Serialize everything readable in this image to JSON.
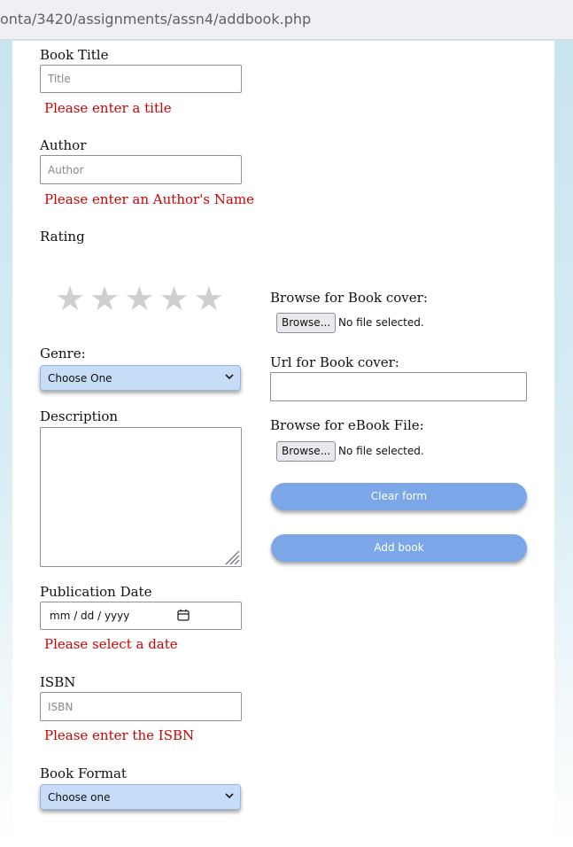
{
  "browser": {
    "url": "onta/3420/assignments/assn4/addbook.php"
  },
  "form": {
    "title": {
      "label": "Book Title",
      "placeholder": "Title",
      "error": "Please enter a title"
    },
    "author": {
      "label": "Author",
      "placeholder": "Author",
      "error": "Please enter an Author's Name"
    },
    "rating": {
      "label": "Rating",
      "stars": [
        "★",
        "★",
        "★",
        "★",
        "★"
      ],
      "value": 0
    },
    "genre": {
      "label": "Genre:",
      "selected": "Choose One"
    },
    "description": {
      "label": "Description"
    },
    "publication_date": {
      "label": "Publication Date",
      "value": "mm / dd / yyyy",
      "error": "Please select a date"
    },
    "isbn": {
      "label": "ISBN",
      "placeholder": "ISBN",
      "error": "Please enter the ISBN"
    },
    "book_format": {
      "label": "Book Format",
      "selected": "Choose one"
    },
    "cover_file": {
      "label": "Browse for Book cover:",
      "button": "Browse...",
      "status": "No file selected."
    },
    "cover_url": {
      "label": "Url for Book cover:"
    },
    "ebook_file": {
      "label": "Browse for eBook File:",
      "button": "Browse...",
      "status": "No file selected."
    },
    "clear_button": "Clear form",
    "add_button": "Add book"
  },
  "colors": {
    "error": "#d40000",
    "button": "#7ba6e8",
    "select": "#c7dcf7",
    "star": "#cfcfcf"
  }
}
